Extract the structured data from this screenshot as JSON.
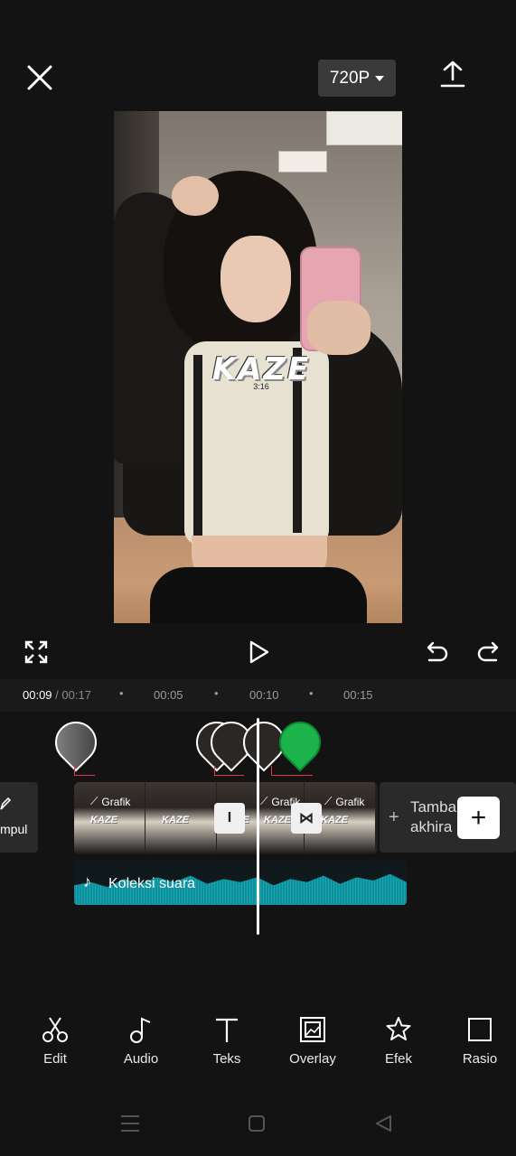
{
  "header": {
    "resolution": "720P"
  },
  "preview": {
    "overlay_text": "KAZE",
    "overlay_sub": "3:16"
  },
  "timeline": {
    "current_time": "00:09",
    "separator": " / ",
    "total_time": "00:17",
    "ticks": [
      "00:05",
      "00:10",
      "00:15"
    ],
    "left_chip_label": "mpul",
    "clip_tag": "Grafik",
    "thumb_text": "KAZE",
    "end_label_1": "Tamba",
    "end_label_2": "akhira",
    "audio_label": "Koleksi suara"
  },
  "toolbar": [
    {
      "label": "Edit",
      "icon": "scissors-icon"
    },
    {
      "label": "Audio",
      "icon": "music-note-icon"
    },
    {
      "label": "Teks",
      "icon": "text-icon"
    },
    {
      "label": "Overlay",
      "icon": "overlay-icon"
    },
    {
      "label": "Efek",
      "icon": "effects-star-icon"
    },
    {
      "label": "Rasio",
      "icon": "ratio-icon"
    }
  ],
  "colors": {
    "background": "#131313",
    "keyframe_green": "#1bb34a",
    "audio_wave": "#17a6b1",
    "marker_red": "#e6324b"
  }
}
